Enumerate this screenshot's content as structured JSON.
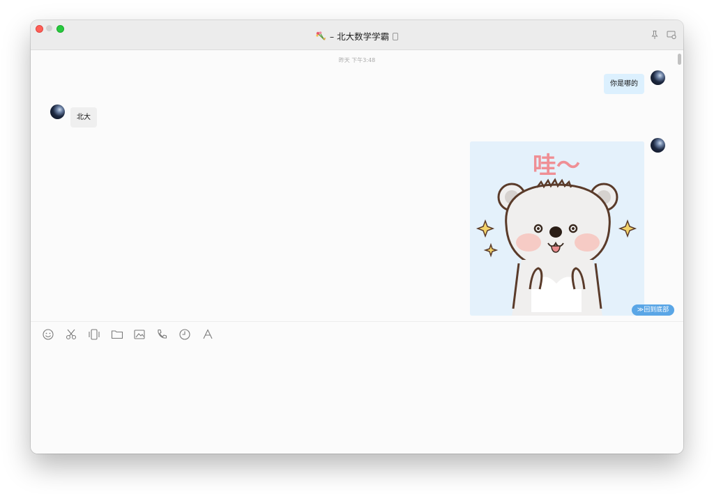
{
  "window": {
    "title": "– 北大数学学霸",
    "title_icon": "flower-bouquet-icon",
    "device_icon": "mobile-phone-icon",
    "header_actions": [
      "pin-icon",
      "chat-settings-icon"
    ]
  },
  "chat": {
    "timestamp": "昨天  下午3:48",
    "messages": [
      {
        "sender": "me",
        "type": "text",
        "text": "你是哪的"
      },
      {
        "sender": "other",
        "type": "text",
        "text": "北大"
      },
      {
        "sender": "me",
        "type": "sticker",
        "sticker_text": "哇～",
        "sticker_desc": "white bear sticker"
      }
    ],
    "back_to_bottom": "回到底部"
  },
  "toolbar": {
    "tools": [
      "emoji-icon",
      "screenshot-scissors-icon",
      "shake-window-icon",
      "folder-icon",
      "image-icon",
      "phone-call-icon",
      "history-clock-icon",
      "font-icon"
    ]
  },
  "colors": {
    "bubble_me": "#dcf0fe",
    "bubble_other": "#efefef",
    "accent": "#5aa6e6",
    "sticker_bg": "#e4f1fb"
  }
}
